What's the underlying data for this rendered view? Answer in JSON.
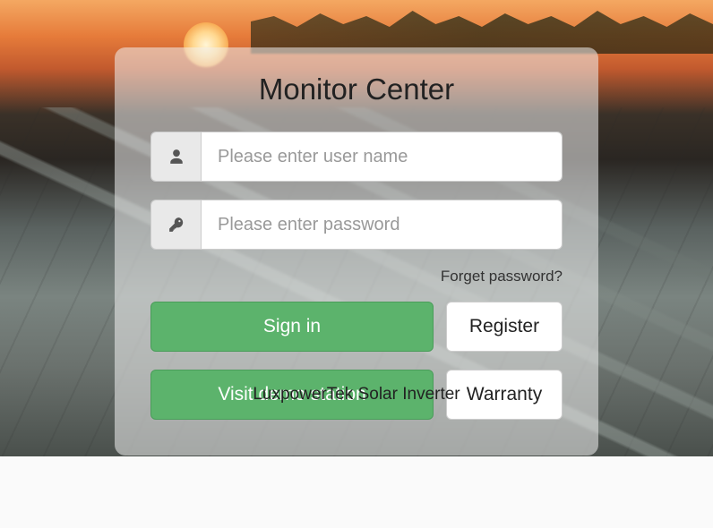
{
  "title": "Monitor Center",
  "username": {
    "value": "",
    "placeholder": "Please enter user name"
  },
  "password": {
    "value": "",
    "placeholder": "Please enter password"
  },
  "forgot": "Forget password?",
  "signIn": "Sign in",
  "register": "Register",
  "demo": "Visit demo station",
  "warranty": "Warranty",
  "footer": "LuxpowerTek Solar Inverter"
}
